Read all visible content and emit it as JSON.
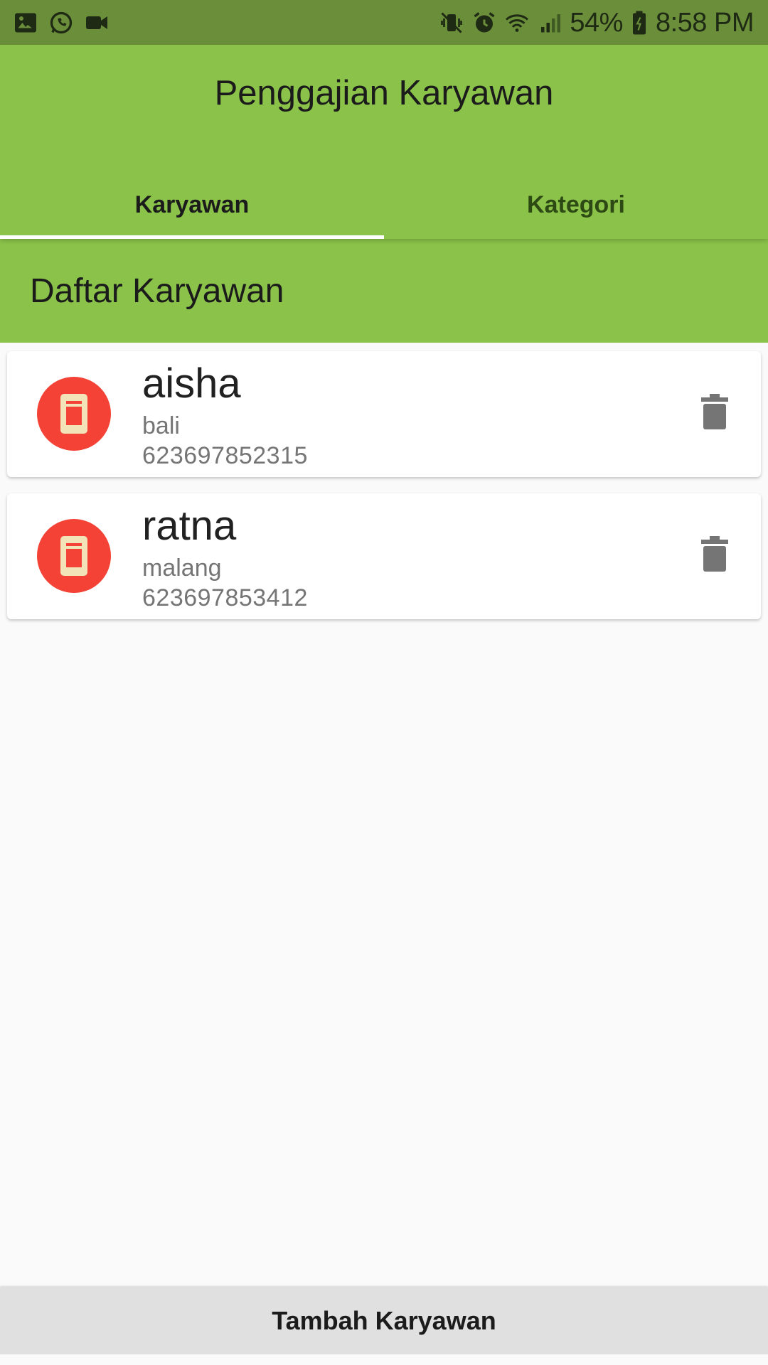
{
  "status_bar": {
    "battery_percent": "54%",
    "time": "8:58 PM",
    "left_icons": [
      "image-icon",
      "whatsapp-icon",
      "video-icon"
    ],
    "right_icons": [
      "vibrate-icon",
      "alarm-icon",
      "wifi-icon",
      "signal-icon",
      "battery-icon"
    ]
  },
  "app": {
    "title": "Penggajian Karyawan",
    "primary_color": "#8bc34a"
  },
  "tabs": [
    {
      "label": "Karyawan",
      "active": true
    },
    {
      "label": "Kategori",
      "active": false
    }
  ],
  "section": {
    "title": "Daftar Karyawan"
  },
  "employees": [
    {
      "name": "aisha",
      "city": "bali",
      "phone": "623697852315",
      "avatar_icon": "phone-icon",
      "avatar_color": "#f44336"
    },
    {
      "name": "ratna",
      "city": "malang",
      "phone": "623697853412",
      "avatar_icon": "phone-icon",
      "avatar_color": "#f44336"
    }
  ],
  "actions": {
    "add_employee_label": "Tambah Karyawan",
    "delete_icon": "trash-icon"
  }
}
